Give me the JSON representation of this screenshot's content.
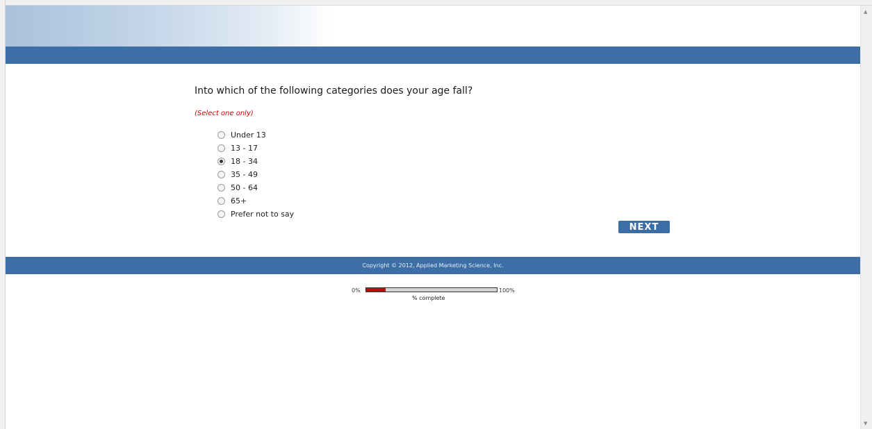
{
  "survey": {
    "question": "Into which of the following categories does your age fall?",
    "instruction_open": "(",
    "instruction_text": "Select one only",
    "instruction_close": ")",
    "options": [
      {
        "label": "Under 13",
        "selected": false
      },
      {
        "label": "13 - 17",
        "selected": false
      },
      {
        "label": "18 - 34",
        "selected": true
      },
      {
        "label": "35 - 49",
        "selected": false
      },
      {
        "label": "50 - 64",
        "selected": false
      },
      {
        "label": "65+",
        "selected": false
      },
      {
        "label": "Prefer not to say",
        "selected": false
      }
    ],
    "next_label": "NEXT"
  },
  "footer": {
    "copyright": "Copyright © 2012, Applied Marketing Science, Inc."
  },
  "progress": {
    "start_label": "0%",
    "end_label": "100%",
    "caption": "% complete",
    "fraction": 0.15
  },
  "colors": {
    "bar": "#3d6fa6",
    "progress_fill": "#b51212",
    "instruction": "#d40000"
  }
}
